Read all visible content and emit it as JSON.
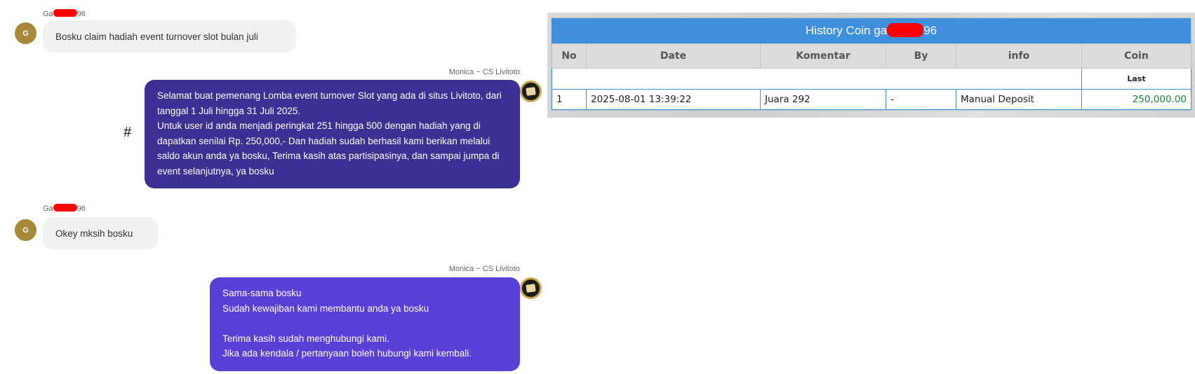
{
  "chat": {
    "user_name_prefix": "Ga",
    "user_name_suffix": "96",
    "user_initial": "G",
    "agent_name": "Monica ~ CS Livitoto",
    "hash_mark": "#",
    "messages": [
      {
        "from": "user",
        "text": "Bosku claim hadiah event turnover slot bulan juli"
      },
      {
        "from": "agent",
        "text": "Selamat buat pemenang Lomba event turnover Slot yang ada di situs Livitoto, dari tanggal 1 Juli hingga 31 Juli 2025.\nUntuk user id anda menjadi peringkat 251 hingga 500 dengan hadiah yang di dapatkan senilai Rp. 250,000,- Dan hadiah sudah berhasil kami berikan melalui saldo akun anda ya bosku, Terima kasih atas partisipasinya, dan sampai jumpa di event selanjutnya, ya bosku"
      },
      {
        "from": "user",
        "text": "Okey mksih bosku"
      },
      {
        "from": "agent",
        "text": "Sama-sama bosku\nSudah kewajiban kami membantu anda ya bosku\n\nTerima kasih sudah menghubungi kami.\nJika ada kendala / pertanyaan boleh hubungi kami kembali."
      }
    ],
    "colors": {
      "agent_bubble_1": "#3b3192",
      "agent_bubble_2": "#5a3fd6",
      "user_bubble": "#f1f1f1",
      "avatar": "#a7883a"
    }
  },
  "history": {
    "title_prefix": "History Coin ga",
    "title_suffix": "96",
    "columns": [
      "No",
      "Date",
      "Komentar",
      "By",
      "info",
      "Coin"
    ],
    "subheader_last": "Last",
    "rows": [
      {
        "no": "1",
        "date": "2025-08-01 13:39:22",
        "komentar": "Juara 292",
        "by": "-",
        "info": "Manual Deposit",
        "coin": "250,000.00"
      }
    ],
    "colors": {
      "title_bg": "#3f8fdc",
      "coin_text": "#178a2e"
    }
  }
}
